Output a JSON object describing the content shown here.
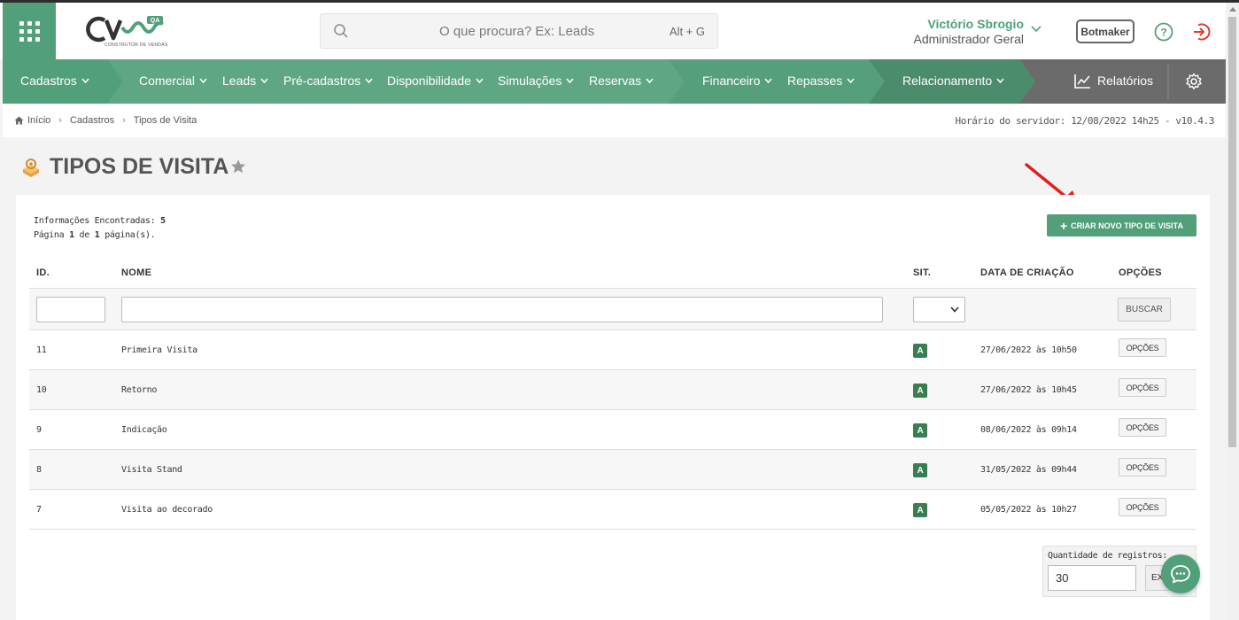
{
  "header": {
    "logo": {
      "text": "CV",
      "badge": "QA",
      "subtitle": "CONSTRUTOR DE VENDAS"
    },
    "search": {
      "placeholder": "O que procura? Ex: Leads",
      "shortcut": "Alt + G"
    },
    "user": {
      "name": "Victório Sbrogio",
      "role": "Administrador Geral"
    },
    "botmaker_label": "Botmaker"
  },
  "nav": {
    "items": [
      {
        "label": "Cadastros"
      },
      {
        "label": "Comercial"
      },
      {
        "label": "Leads"
      },
      {
        "label": "Pré-cadastros"
      },
      {
        "label": "Disponibilidade"
      },
      {
        "label": "Simulações"
      },
      {
        "label": "Reservas"
      },
      {
        "label": "Financeiro"
      },
      {
        "label": "Repasses"
      },
      {
        "label": "Relacionamento"
      }
    ],
    "reports_label": "Relatórios",
    "colors": {
      "seg1": "#52a07a",
      "seg2": "#5fa783",
      "seg3": "#559f7a",
      "seg4": "#4a8c6c",
      "reports": "#6b6b6b"
    }
  },
  "breadcrumb": {
    "items": [
      "Início",
      "Cadastros",
      "Tipos de Visita"
    ],
    "server_time": "Horário do servidor: 12/08/2022 14h25 - v10.4.3"
  },
  "page": {
    "title": "TIPOS DE VISITA",
    "info_found_label": "Informações Encontradas:",
    "info_found_value": "5",
    "page_prefix": "Página",
    "page_current": "1",
    "page_of": "de",
    "page_total": "1",
    "page_suffix": "página(s).",
    "create_button": "CRIAR NOVO TIPO DE VISITA"
  },
  "table": {
    "columns": [
      "ID.",
      "NOME",
      "SIT.",
      "DATA DE CRIAÇÃO",
      "OPÇÕES"
    ],
    "search_button": "BUSCAR",
    "rows": [
      {
        "id": "11",
        "name": "Primeira Visita",
        "status": "A",
        "created": "27/06/2022 às 10h50",
        "options": "OPÇÕES"
      },
      {
        "id": "10",
        "name": "Retorno",
        "status": "A",
        "created": "27/06/2022 às 10h45",
        "options": "OPÇÕES"
      },
      {
        "id": "9",
        "name": "Indicação",
        "status": "A",
        "created": "08/06/2022 às 09h14",
        "options": "OPÇÕES"
      },
      {
        "id": "8",
        "name": "Visita Stand",
        "status": "A",
        "created": "31/05/2022 às 09h44",
        "options": "OPÇÕES"
      },
      {
        "id": "7",
        "name": "Visita ao decorado",
        "status": "A",
        "created": "05/05/2022 às 10h27",
        "options": "OPÇÕES"
      }
    ]
  },
  "records": {
    "label": "Quantidade de registros:",
    "value": "30",
    "button": "EX"
  },
  "colors": {
    "brand": "#52a07a",
    "status_badge": "#3a7d51",
    "logout": "#d9412b",
    "arrow": "#e0201b"
  }
}
